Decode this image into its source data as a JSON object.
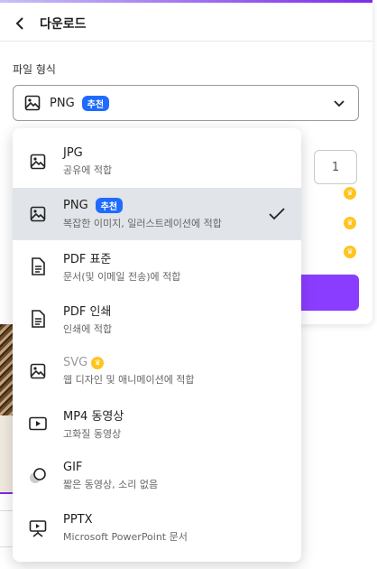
{
  "header": {
    "back_icon": "chevron-left-icon",
    "title": "다운로드"
  },
  "format": {
    "label": "파일 형식",
    "selected_value": "PNG",
    "selected_badge": "추천"
  },
  "quantity": {
    "value": "1"
  },
  "menu": {
    "items": [
      {
        "name": "JPG",
        "desc": "공유에 적합",
        "icon": "image-icon"
      },
      {
        "name": "PNG",
        "badge": "추천",
        "desc": "복잡한 이미지, 일러스트레이션에 적합",
        "icon": "image-icon",
        "selected": true
      },
      {
        "name": "PDF 표준",
        "desc": "문서(및 이메일 전송)에 적합",
        "icon": "document-icon"
      },
      {
        "name": "PDF 인쇄",
        "desc": "인쇄에 적합",
        "icon": "document-icon"
      },
      {
        "name": "SVG",
        "desc": "웹 디자인 및 애니메이션에 적합",
        "icon": "image-icon",
        "premium": true
      },
      {
        "name": "MP4 동영상",
        "desc": "고화질 동영상",
        "icon": "video-icon"
      },
      {
        "name": "GIF",
        "desc": "짧은 동영상, 소리 없음",
        "icon": "gif-icon"
      },
      {
        "name": "PPTX",
        "desc": "Microsoft PowerPoint 문서",
        "icon": "presentation-icon"
      }
    ]
  },
  "colors": {
    "accent": "#8b3dff",
    "badge": "#1f6bff",
    "crown": "#ffc41f",
    "selected_row": "#e1e4e8"
  }
}
